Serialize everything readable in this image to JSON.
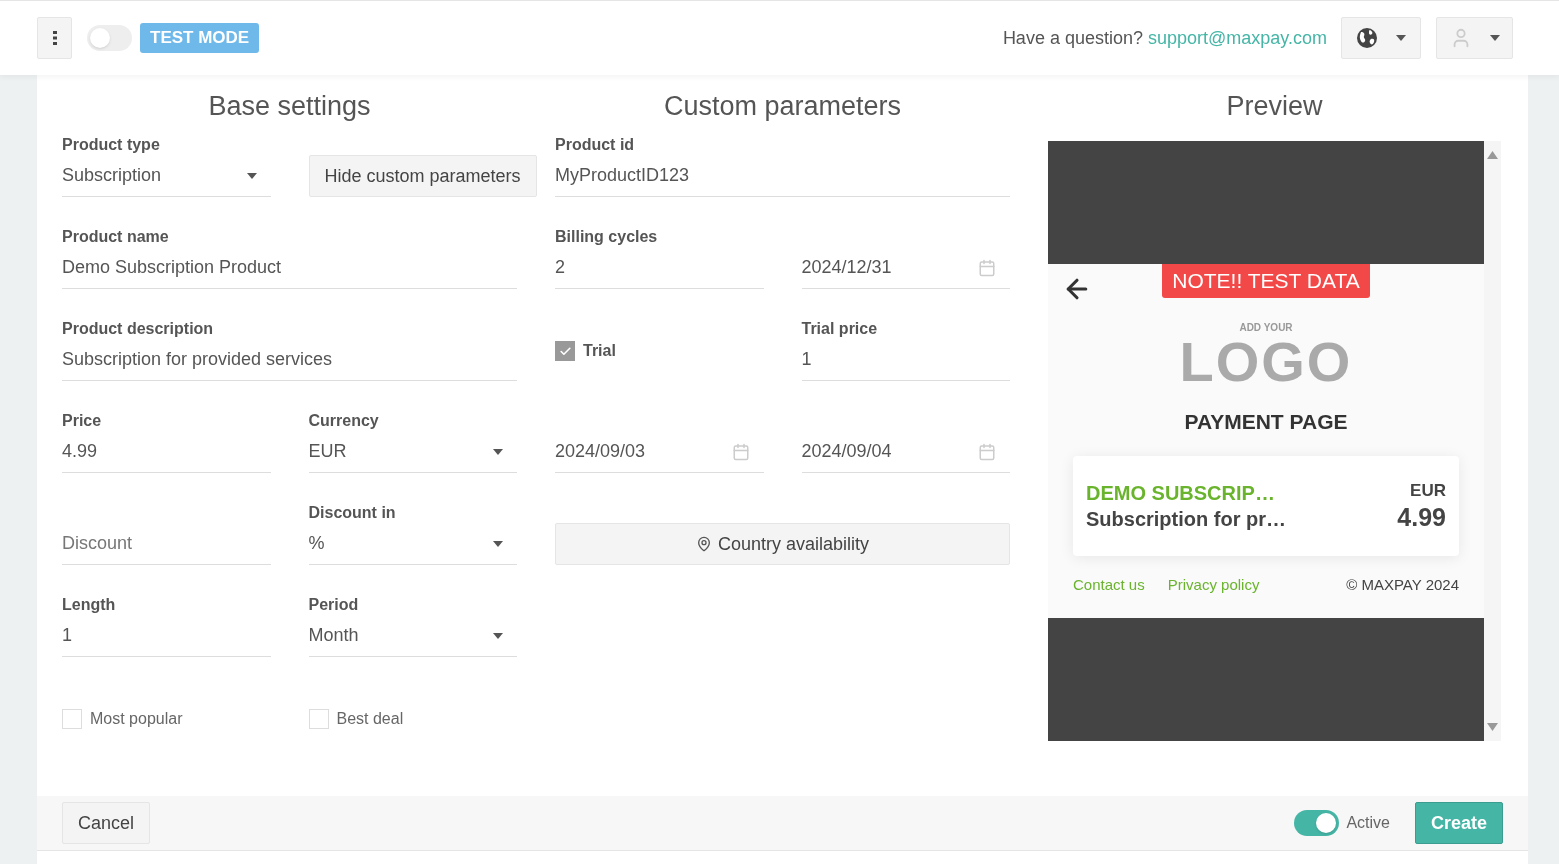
{
  "header": {
    "test_mode": {
      "on": false,
      "label": "TEST MODE"
    },
    "question": "Have a question?",
    "support_email": "support@maxpay.com"
  },
  "base_settings": {
    "title": "Base settings",
    "rows": [
      [
        {
          "kind": "select",
          "label": "Product type",
          "value": "Subscription"
        },
        {
          "kind": "button",
          "label": "Hide custom parameters"
        }
      ],
      [
        {
          "kind": "text",
          "label": "Product name",
          "value": "Demo Subscription Product"
        }
      ],
      [
        {
          "kind": "text",
          "label": "Product description",
          "value": "Subscription for provided services"
        }
      ],
      [
        {
          "kind": "text",
          "label": "Price",
          "value": "4.99"
        },
        {
          "kind": "select",
          "label": "Currency",
          "value": "EUR"
        }
      ],
      [
        {
          "kind": "text",
          "placeholder": "Discount"
        },
        {
          "kind": "select",
          "label": "Discount in",
          "value": "%"
        }
      ],
      [
        {
          "kind": "text",
          "label": "Length",
          "value": "1"
        },
        {
          "kind": "select",
          "label": "Period",
          "value": "Month"
        }
      ],
      [
        {
          "kind": "checkbox",
          "label": "Most popular",
          "checked": false
        },
        {
          "kind": "checkbox",
          "label": "Best deal",
          "checked": false
        }
      ]
    ]
  },
  "custom_parameters": {
    "title": "Custom parameters",
    "rows": [
      [
        {
          "kind": "text",
          "label": "Product id",
          "value": "MyProductID123"
        }
      ],
      [
        {
          "kind": "text",
          "label": "Billing cycles",
          "value": "2"
        },
        {
          "kind": "date",
          "value": "2024/12/31"
        }
      ],
      [
        {
          "kind": "checkbox",
          "label": "Trial",
          "checked": true
        },
        {
          "kind": "text",
          "label": "Trial price",
          "value": "1"
        }
      ],
      [
        {
          "kind": "date",
          "value": "2024/09/03"
        },
        {
          "kind": "date",
          "value": "2024/09/04"
        }
      ]
    ],
    "country_button": {
      "kind": "location",
      "label": "Country availability"
    }
  },
  "preview": {
    "title": "Preview",
    "note": "NOTE!! TEST DATA",
    "logo_caption": "ADD YOUR",
    "logo_text": "LOGO",
    "page_title": "PAYMENT PAGE",
    "product": {
      "name": "DEMO SUBSCRIP…",
      "description": "Subscription for pr…",
      "currency": "EUR",
      "price": "4.99"
    },
    "links": [
      "Contact us",
      "Privacy policy"
    ],
    "copyright": "© MAXPAY 2024"
  },
  "footer": {
    "cancel": "Cancel",
    "active": {
      "on": true,
      "label": "Active"
    },
    "create": "Create"
  }
}
